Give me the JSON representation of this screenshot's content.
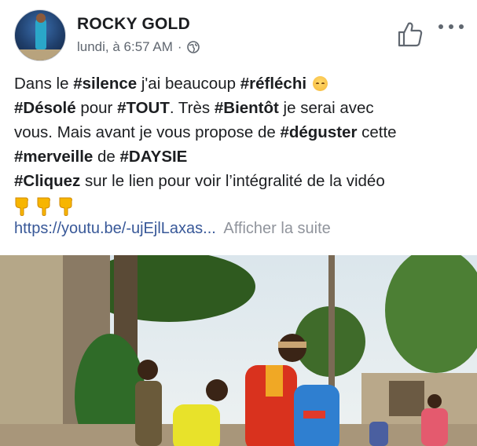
{
  "post": {
    "author": "ROCKY GOLD",
    "timestamp": "lundi, à 6:57 AM",
    "separator": "·",
    "audience_icon": "globe-icon",
    "actions": {
      "like_icon": "thumbs-up-icon",
      "more_icon": "more-options-icon"
    },
    "text": {
      "l1_a": "Dans le ",
      "l1_b": "#silence",
      "l1_c": " j'ai beaucoup ",
      "l1_d": "#réfléchi",
      "l1_emoji": "pensive-face-emoji",
      "l2_a": "#Désolé",
      "l2_b": " pour ",
      "l2_c": "#TOUT",
      "l2_d": ". Très ",
      "l2_e": "#Bientôt",
      "l2_f": " je serai avec",
      "l3_a": "vous. Mais avant je vous propose de ",
      "l3_b": "#déguster",
      "l3_c": " cette",
      "l4_a": "#merveille",
      "l4_b": " de ",
      "l4_c": "#DAYSIE",
      "l5_a": "#Cliquez",
      "l5_b": " sur le lien pour voir l’intégralité de la vidéo",
      "hands_emoji": "backhand-index-pointing-down-emoji"
    },
    "link": "https://youtu.be/-ujEjlLaxas...",
    "see_more": "Afficher la suite"
  },
  "colors": {
    "link": "#385898",
    "secondary_text": "#606770",
    "see_more": "#90949c"
  }
}
